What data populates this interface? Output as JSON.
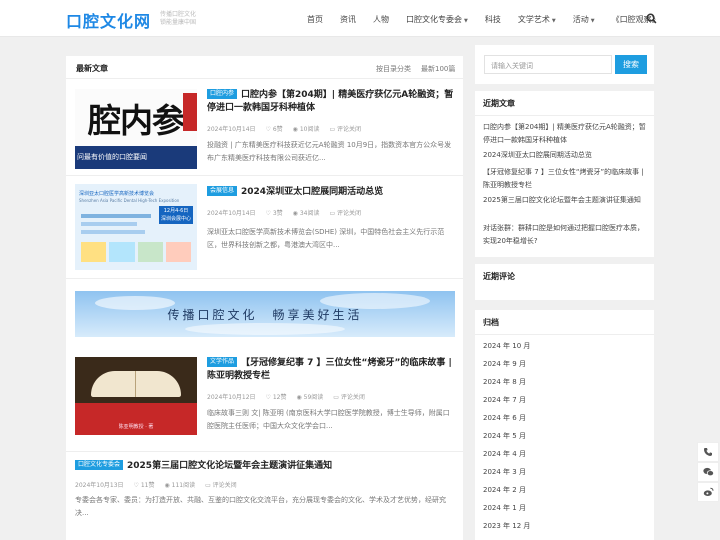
{
  "header": {
    "logo": "口腔文化网",
    "slogan_line1": "传播口腔文化",
    "slogan_line2": "锁能量康中国",
    "nav": [
      "首页",
      "资讯",
      "人物",
      "口腔文化专委会",
      "科技",
      "文学艺术",
      "活动",
      "《口腔观察》"
    ],
    "nav_dropdown": [
      false,
      false,
      false,
      true,
      false,
      true,
      true,
      false
    ]
  },
  "main": {
    "title": "最新文章",
    "links": [
      "按目录分类",
      "最新100篇"
    ],
    "posts": [
      {
        "tag": "口腔内参",
        "title": "口腔内参【第204期】| 精美医疗获亿元A轮融资；暂停进口一款韩国牙科种植体",
        "date": "2024年10月14日",
        "likes": "6赞",
        "views": "10阅读",
        "comments": "评论关闭",
        "excerpt": "投融资 | 广东精美医疗科技获近亿元A轮融资 10月9日，指数资本官方公众号发布广东精美医疗科技有限公司获近亿..."
      },
      {
        "tag": "会展信息",
        "title": "2024深圳亚太口腔展同期活动总览",
        "date": "2024年10月14日",
        "likes": "3赞",
        "views": "34阅读",
        "comments": "评论关闭",
        "excerpt": "深圳亚太口腔医学高新技术博览会(SDHE) 深圳，中国特色社会主义先行示范区，世界科技创新之都，粤港澳大湾区中..."
      },
      {
        "tag": "文学作品",
        "title": "【牙冠修复纪事 7 】三位女性“烤瓷牙”的临床故事 | 陈亚明教授专栏",
        "date": "2024年10月12日",
        "likes": "12赞",
        "views": "59阅读",
        "comments": "评论关闭",
        "excerpt": "临床故事三则 文| 陈亚明 (南京医科大学口腔医学院教授，博士生导师，附属口腔医院主任医师；中国大众文化学会口..."
      },
      {
        "tag": "口腔文化专委会",
        "title": "2025第三届口腔文化论坛暨年会主题演讲征集通知",
        "date": "2024年10月13日",
        "likes": "11赞",
        "views": "111阅读",
        "comments": "评论关闭",
        "excerpt": "专委会各专家、委员：为打造开放、共融、互鉴的口腔文化交流平台，充分展现专委会的文化、学术及才艺优势，经研究决..."
      }
    ],
    "thumb1_text": "腔内参",
    "thumb1_sub": "问最有价值的口腔要闻",
    "thumb2_heading": "深圳亚太口腔医学高新技术博览会",
    "thumb2_sub": "Shenzhen Asia Pacific Dental High-Tech Exposition",
    "thumb2_date_line1": "12月4-6日",
    "thumb2_date_line2": "深圳会展中心",
    "thumb3_caption": "陈亚明教授 · 著",
    "banner_text": "传播口腔文化　畅享美好生活"
  },
  "sidebar": {
    "search_placeholder": "请输入关键词",
    "search_button": "搜索",
    "recent_title": "近期文章",
    "recent": [
      "口腔内参【第204期】| 精美医疗获亿元A轮融资；暂停进口一款韩国牙科种植体",
      "2024深圳亚太口腔展同期活动总览",
      "【牙冠修复纪事 7 】三位女性“烤瓷牙”的临床故事 | 陈亚明教授专栏",
      "2025第三届口腔文化论坛暨年会主题演讲征集通知",
      "对话张群：群耕口腔是如何通过把握口腔医疗本质，实现20年稳增长?"
    ],
    "comments_title": "近期评论",
    "archive_title": "归档",
    "archive": [
      "2024 年 10 月",
      "2024 年 9 月",
      "2024 年 8 月",
      "2024 年 7 月",
      "2024 年 6 月",
      "2024 年 5 月",
      "2024 年 4 月",
      "2024 年 3 月",
      "2024 年 2 月",
      "2024 年 1 月",
      "2023 年 12 月"
    ]
  },
  "colors": {
    "accent": "#1e9de0",
    "logo": "#1e88e5"
  }
}
